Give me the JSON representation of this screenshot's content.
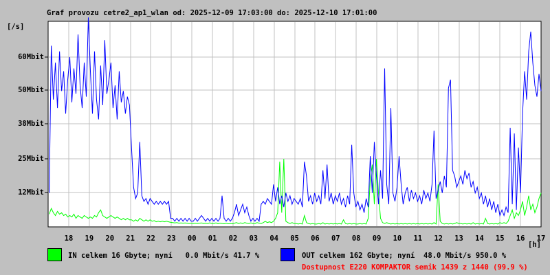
{
  "header": {
    "title": "Graf provozu cetre2_ap1_wlan od: 2025-12-09 17:03:00 do: 2025-12-10 17:01:00"
  },
  "axes": {
    "y_unit": "[/s]",
    "x_unit": "[h]",
    "y_ticks": [
      "60Mbit",
      "50Mbit",
      "38Mbit",
      "25Mbit",
      "12Mbit"
    ],
    "x_ticks": [
      "18",
      "19",
      "20",
      "21",
      "22",
      "23",
      "00",
      "01",
      "02",
      "03",
      "04",
      "05",
      "06",
      "07",
      "08",
      "09",
      "10",
      "11",
      "12",
      "13",
      "14",
      "15",
      "16",
      "17"
    ]
  },
  "legend": {
    "in_label": "IN celkem 16 Gbyte; nyní   0.0 Mbit/s 41.7 %",
    "out_label": "OUT celkem 162 Gbyte; nyní  48.0 Mbit/s 950.0 %",
    "availability": "Dostupnost E220 KOMPAKTOR semik 1439 z 1440 (99.9 %)",
    "in_color": "#00ff00",
    "out_color": "#0000ff",
    "availability_color": "#ff0000"
  },
  "chart_data": {
    "type": "line",
    "title": "Graf provozu cetre2_ap1_wlan od: 2025-12-09 17:03:00 do: 2025-12-10 17:01:00",
    "xlabel": "[h]",
    "ylabel": "[/s]",
    "x_start_hour": "17:03",
    "x_end_hour": "17:01",
    "x_tick_labels": [
      "18",
      "19",
      "20",
      "21",
      "22",
      "23",
      "00",
      "01",
      "02",
      "03",
      "04",
      "05",
      "06",
      "07",
      "08",
      "09",
      "10",
      "11",
      "12",
      "13",
      "14",
      "15",
      "16",
      "17"
    ],
    "y_gridline_values_mbit": [
      60,
      50,
      38,
      25,
      12
    ],
    "ylim": [
      0,
      72.5
    ],
    "grid": true,
    "legend_position": "bottom",
    "sample_interval_minutes": 6,
    "series": [
      {
        "name": "IN",
        "color": "#00ff00",
        "unit": "Mbit/s",
        "values": [
          4.5,
          6.5,
          5,
          4,
          5.5,
          4.5,
          5,
          4,
          4.5,
          3.5,
          4,
          3.5,
          4.5,
          3,
          4,
          3.5,
          3,
          4,
          3.5,
          3,
          3.5,
          3,
          4,
          3.5,
          5,
          6,
          4,
          3.5,
          3,
          3.5,
          4,
          3.5,
          3,
          3.5,
          3,
          2.5,
          3,
          2.5,
          3,
          2.5,
          2.5,
          2,
          2.5,
          2,
          3,
          2.5,
          2,
          2.5,
          2,
          2.5,
          2,
          2.2,
          1.8,
          2,
          1.8,
          2,
          1.8,
          2,
          1.8,
          1.6,
          1.5,
          1.4,
          1.5,
          1.3,
          1.4,
          1.3,
          1.4,
          1.3,
          1.2,
          1.3,
          1.2,
          1.3,
          1.2,
          1.3,
          1.4,
          1.2,
          1.3,
          1.2,
          1.4,
          1.2,
          1.2,
          1.4,
          1.1,
          1.3,
          1.2,
          1.1,
          1.3,
          1.1,
          1.2,
          1.1,
          1.3,
          1.5,
          1.2,
          1.4,
          1.2,
          1.5,
          1.3,
          1.2,
          1.4,
          1.2,
          1.2,
          1.5,
          1.3,
          1.2,
          1.5,
          2,
          1.5,
          1.8,
          1.5,
          2,
          3,
          5,
          23,
          5,
          24,
          2,
          1.5,
          1.2,
          1.5,
          1.2,
          1.2,
          1,
          1.2,
          1,
          4,
          1.5,
          1.2,
          1,
          1.2,
          1,
          1,
          1.2,
          1,
          1.5,
          1,
          1.2,
          1,
          1.2,
          1,
          1.2,
          1,
          1.2,
          1,
          2.5,
          1.2,
          1,
          1.2,
          1,
          1.2,
          1,
          1,
          1.2,
          1,
          1.2,
          1,
          3,
          17,
          22,
          8,
          24,
          12,
          3,
          1.5,
          1.2,
          1.5,
          1.2,
          1,
          1.2,
          1,
          1.2,
          1,
          1.2,
          1,
          1.2,
          1,
          1.2,
          1,
          1.2,
          1,
          1.2,
          1,
          1.2,
          1,
          1.2,
          1,
          1.2,
          1,
          1.5,
          1,
          15,
          2,
          1.2,
          1,
          1.2,
          1,
          1.2,
          1,
          1.2,
          1.5,
          1.2,
          1.2,
          1,
          1.2,
          1,
          1.2,
          1,
          1.5,
          1,
          1.2,
          1,
          1.2,
          1,
          3,
          1.2,
          1,
          1.2,
          1,
          1.2,
          1,
          1.5,
          1.2,
          1.5,
          1.2,
          2,
          4,
          6,
          3,
          5,
          4,
          6,
          9,
          4,
          7,
          11,
          6,
          8,
          5,
          7,
          10,
          12
        ]
      },
      {
        "name": "OUT",
        "color": "#0000ff",
        "unit": "Mbit/s",
        "values": [
          12,
          64,
          45,
          58,
          42,
          62,
          48,
          55,
          40,
          52,
          60,
          44,
          56,
          47,
          68,
          50,
          42,
          58,
          46,
          74,
          55,
          40,
          62,
          45,
          38,
          57,
          43,
          66,
          47,
          52,
          58,
          42,
          50,
          38,
          55,
          44,
          48,
          40,
          46,
          43,
          28,
          14,
          10,
          12,
          30,
          11,
          9,
          10,
          8,
          10,
          9,
          8,
          9,
          8,
          9,
          8,
          9,
          8,
          9,
          3,
          3,
          2,
          3,
          2,
          3,
          2,
          3,
          2,
          3,
          2,
          2,
          3,
          2,
          3,
          4,
          3,
          2,
          3,
          2,
          3,
          2,
          3,
          2,
          3,
          11,
          3,
          2,
          3,
          2,
          3,
          5,
          8,
          4,
          6,
          8,
          5,
          7,
          4,
          2,
          3,
          2,
          3,
          2,
          8,
          9,
          8,
          10,
          9,
          8,
          15,
          9,
          14,
          8,
          11,
          7,
          12,
          9,
          11,
          8,
          10,
          9,
          8,
          10,
          7,
          23,
          18,
          9,
          11,
          8,
          12,
          9,
          11,
          8,
          20,
          10,
          22,
          9,
          12,
          8,
          11,
          9,
          12,
          8,
          10,
          7,
          11,
          8,
          29,
          12,
          7,
          9,
          6,
          8,
          5,
          10,
          7,
          25,
          12,
          30,
          18,
          8,
          20,
          10,
          56,
          15,
          8,
          42,
          12,
          9,
          14,
          25,
          15,
          8,
          12,
          14,
          9,
          13,
          10,
          12,
          9,
          11,
          8,
          13,
          10,
          12,
          9,
          15,
          34,
          10,
          13,
          16,
          12,
          18,
          14,
          49,
          52,
          20,
          18,
          14,
          16,
          18,
          15,
          20,
          17,
          19,
          14,
          16,
          12,
          14,
          10,
          12,
          8,
          11,
          7,
          10,
          6,
          9,
          5,
          8,
          4,
          6,
          4,
          7,
          5,
          35,
          8,
          33,
          6,
          28,
          12,
          40,
          55,
          45,
          62,
          69,
          58,
          50,
          46,
          54,
          48
        ]
      }
    ]
  }
}
